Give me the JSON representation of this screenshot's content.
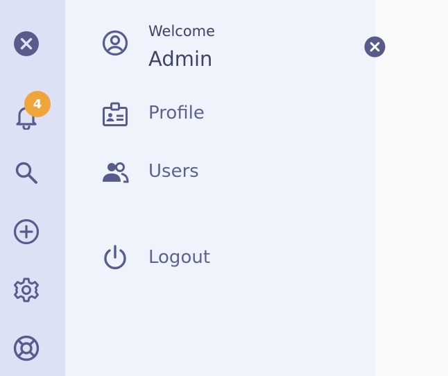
{
  "rail": {
    "icons": [
      "close-icon",
      "bell-icon",
      "search-icon",
      "plus-circle-icon",
      "gear-icon",
      "lifebuoy-icon"
    ],
    "notification_count": "4"
  },
  "panel": {
    "welcome": "Welcome",
    "user_name": "Admin",
    "items": [
      {
        "label": "Profile",
        "icon": "id-badge-icon"
      },
      {
        "label": "Users",
        "icon": "users-icon"
      },
      {
        "label": "Logout",
        "icon": "power-icon"
      }
    ]
  },
  "colors": {
    "rail_bg": "#dde1f5",
    "panel_bg": "#eff3fc",
    "icon": "#585b8c",
    "badge": "#f0a43c"
  }
}
